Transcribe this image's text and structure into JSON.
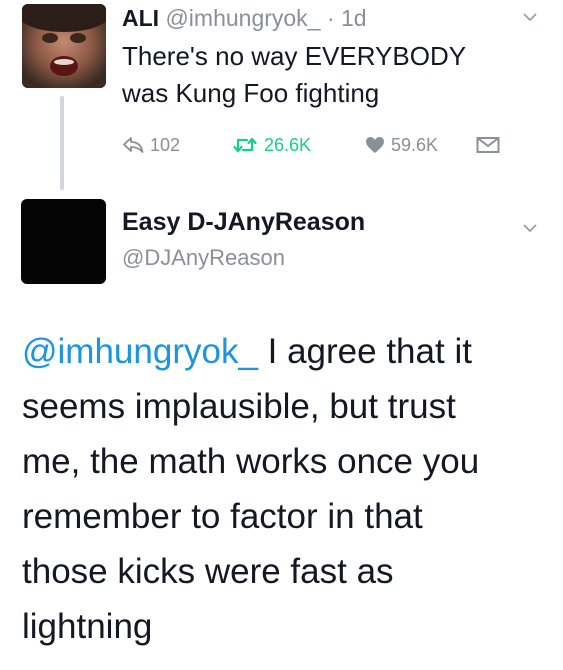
{
  "tweet1": {
    "author_name": "ALI",
    "handle": "@imhungryok_",
    "separator": "·",
    "time": "1d",
    "text_lines": [
      "There's no way EVERYBODY",
      "was Kung Foo fighting"
    ],
    "actions": {
      "reply_icon": "reply-icon",
      "reply_count": "102",
      "retweet_icon": "retweet-icon",
      "retweet_count": "26.6K",
      "like_icon": "heart-icon",
      "like_count": "59.6K",
      "dm_icon": "direct-message-icon"
    },
    "menu_icon": "chevron-down-icon"
  },
  "tweet2": {
    "author_name": "Easy D-JAnyReason",
    "handle": "@DJAnyReason",
    "menu_icon": "chevron-down-icon",
    "mention": "@imhungryok_",
    "text_lines": [
      " I agree that it",
      "seems implausible, but trust",
      "me, the math works once you",
      "remember to factor in that",
      "those kicks were fast as",
      "lightning"
    ]
  },
  "colors": {
    "retweet_active": "#19cf86",
    "mention": "#1b95e0",
    "muted": "#8a9097",
    "text": "#141823"
  }
}
